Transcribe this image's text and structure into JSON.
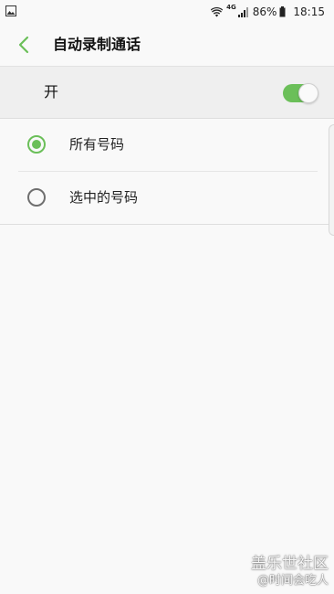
{
  "status_bar": {
    "network": "4G",
    "battery_percent": "86%",
    "time": "18:15"
  },
  "header": {
    "back_icon": "chevron-left-icon",
    "title": "自动录制通话"
  },
  "master_switch": {
    "label": "开",
    "on": true
  },
  "options": [
    {
      "label": "所有号码",
      "selected": true
    },
    {
      "label": "选中的号码",
      "selected": false
    }
  ],
  "colors": {
    "accent": "#6bbf59",
    "radio_off": "#6f6f6f",
    "background": "#f9f9f9",
    "switch_row_bg": "#efefef"
  },
  "watermark": {
    "line1": "盖乐世社区",
    "line2": "@时间会吃人"
  }
}
